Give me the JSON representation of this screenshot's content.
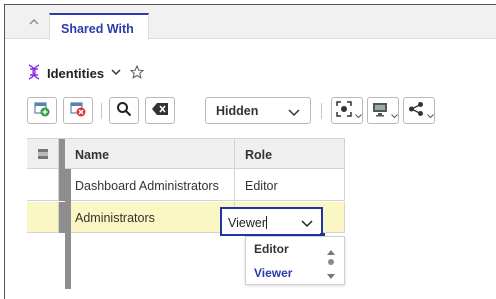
{
  "tab": {
    "label": "Shared With"
  },
  "section": {
    "title": "Identities"
  },
  "toolbar": {
    "filter_value": "Hidden"
  },
  "grid": {
    "columns": [
      "Name",
      "Role"
    ],
    "rows": [
      {
        "name": "Dashboard Administrators",
        "role": "Editor"
      },
      {
        "name": "Administrators",
        "role": "Viewer"
      }
    ]
  },
  "role_editor": {
    "value": "Viewer",
    "options": [
      "Editor",
      "Viewer"
    ],
    "selected_option": "Viewer"
  },
  "colors": {
    "accent": "#2b3ca8",
    "selected_row": "#fbf7c4",
    "header_row": "#efefef"
  },
  "icons": [
    "collapse-chevron-icon",
    "identities-icon",
    "chevron-down-icon",
    "star-icon",
    "add-user-icon",
    "remove-user-icon",
    "search-icon",
    "clear-icon",
    "focus-icon",
    "screen-icon",
    "share-icon",
    "flag-icon"
  ]
}
